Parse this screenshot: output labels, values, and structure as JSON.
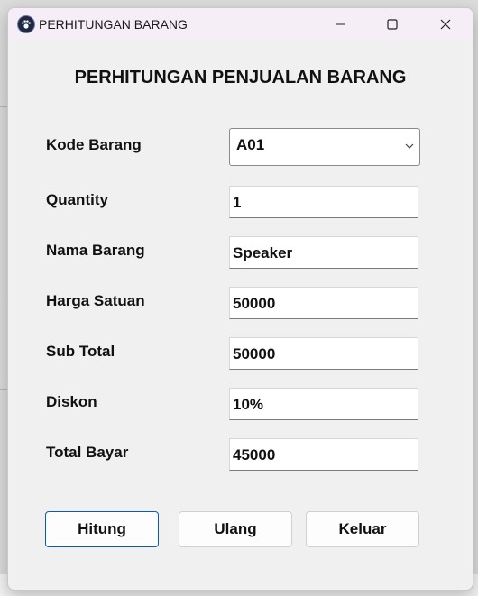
{
  "window": {
    "title": "PERHITUNGAN BARANG",
    "icon": "paw-icon"
  },
  "form": {
    "heading": "PERHITUNGAN PENJUALAN BARANG",
    "kode_barang": {
      "label": "Kode Barang",
      "value": "A01"
    },
    "quantity": {
      "label": "Quantity",
      "value": "1"
    },
    "nama_barang": {
      "label": "Nama Barang",
      "value": "Speaker"
    },
    "harga_satuan": {
      "label": "Harga Satuan",
      "value": "50000"
    },
    "sub_total": {
      "label": "Sub Total",
      "value": "50000"
    },
    "diskon": {
      "label": "Diskon",
      "value": "10%"
    },
    "total_bayar": {
      "label": "Total Bayar",
      "value": "45000"
    }
  },
  "buttons": {
    "hitung": "Hitung",
    "ulang": "Ulang",
    "keluar": "Keluar"
  },
  "colors": {
    "primary_border": "#0b5cad",
    "titlebar": "#f5eef6"
  }
}
